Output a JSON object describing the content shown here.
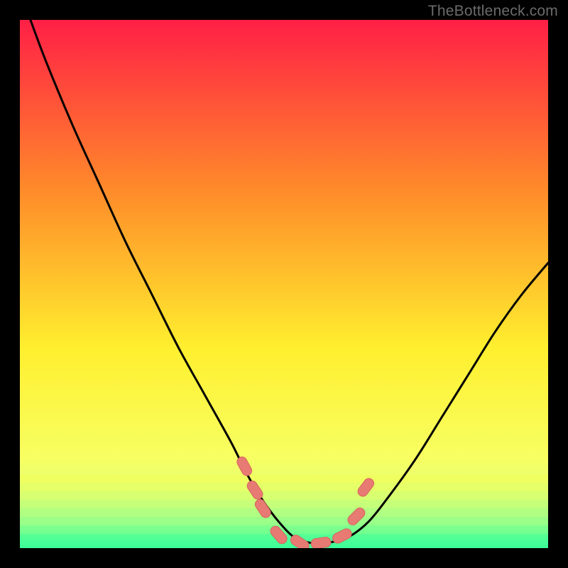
{
  "attribution": "TheBottleneck.com",
  "colors": {
    "gradient_top": "#ff1f46",
    "gradient_mid_upper": "#ff8a2a",
    "gradient_mid": "#ffef2e",
    "gradient_lower": "#f7ff62",
    "gradient_band1": "#e0ff78",
    "gradient_band2": "#b7ff87",
    "gradient_bottom": "#36ff9a",
    "curve": "#000000",
    "marker_fill": "#e77b74",
    "marker_stroke": "#d8615c",
    "frame": "#000000"
  },
  "chart_data": {
    "type": "line",
    "title": "",
    "xlabel": "",
    "ylabel": "",
    "xlim": [
      0,
      100
    ],
    "ylim": [
      0,
      100
    ],
    "series": [
      {
        "name": "bottleneck-curve",
        "x": [
          2,
          5,
          10,
          15,
          20,
          25,
          30,
          35,
          40,
          43,
          46,
          49,
          52,
          55,
          58,
          62,
          66,
          70,
          75,
          80,
          85,
          90,
          95,
          100
        ],
        "y": [
          100,
          92,
          80,
          69,
          58,
          48,
          38,
          29,
          20,
          14,
          9,
          5,
          2,
          1,
          1,
          2,
          5,
          10,
          17,
          25,
          33,
          41,
          48,
          54
        ]
      }
    ],
    "markers": [
      {
        "x": 42.5,
        "y": 15.5
      },
      {
        "x": 44.5,
        "y": 11.0
      },
      {
        "x": 46.0,
        "y": 7.5
      },
      {
        "x": 49.0,
        "y": 2.5
      },
      {
        "x": 53.0,
        "y": 1.0
      },
      {
        "x": 57.0,
        "y": 1.0
      },
      {
        "x": 61.0,
        "y": 2.3
      },
      {
        "x": 63.7,
        "y": 6.0
      },
      {
        "x": 65.5,
        "y": 11.5
      }
    ]
  }
}
